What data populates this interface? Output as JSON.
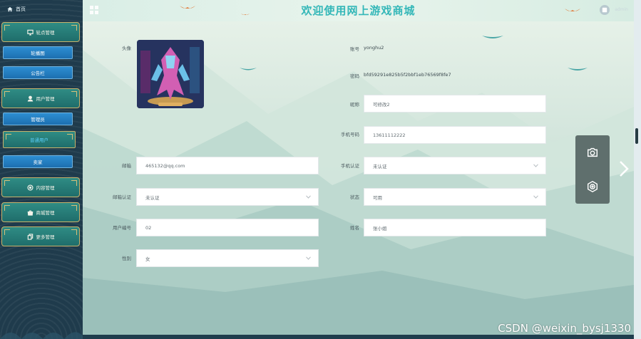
{
  "app": {
    "title": "欢迎使用网上游戏商城"
  },
  "sidebar": {
    "home_label": "首页",
    "groups": [
      {
        "label": "轮点管理",
        "icon": "monitor-icon"
      },
      {
        "label": "用户管理",
        "icon": "user-icon"
      },
      {
        "label": "内容管理",
        "icon": "circle-dot-icon"
      },
      {
        "label": "商城管理",
        "icon": "bag-icon"
      },
      {
        "label": "更多管理",
        "icon": "copy-icon"
      }
    ],
    "subs": [
      {
        "label": "轮播图"
      },
      {
        "label": "公告栏"
      },
      {
        "label": "管理员"
      },
      {
        "label": "普通用户",
        "active": true
      },
      {
        "label": "卖家"
      }
    ]
  },
  "header": {
    "user": "admin"
  },
  "form": {
    "avatar_label": "头像",
    "account_label": "账号",
    "account_value": "yonghu2",
    "password_label": "密码",
    "password_value": "bfd59291e825b5f2bbf1eb76569f8fe7",
    "nickname_label": "昵称",
    "nickname_value": "可修改2",
    "phone_label": "手机号码",
    "phone_value": "13611112222",
    "email_label": "邮箱",
    "email_value": "465132@qq.com",
    "phone_verify_label": "手机认证",
    "phone_verify_value": "未认证",
    "email_verify_label": "邮箱认证",
    "email_verify_value": "未认证",
    "status_label": "状态",
    "status_value": "可用",
    "user_no_label": "用户编号",
    "user_no_value": "02",
    "name_label": "姓名",
    "name_value": "张小姐",
    "gender_label": "性别",
    "gender_value": "女"
  },
  "watermark": "CSDN @weixin_bysj1330",
  "colors": {
    "title": "#33b7b8",
    "menu_group": "#2f8c84",
    "menu_sub": "#2d8ed2",
    "gold_border": "#c9b26a"
  }
}
